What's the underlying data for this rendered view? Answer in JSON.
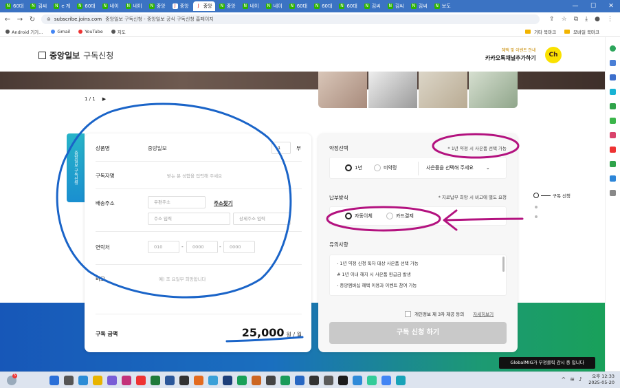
{
  "browser": {
    "tabs": [
      {
        "label": "60대",
        "icon": "N"
      },
      {
        "label": "김씨",
        "icon": "N"
      },
      {
        "label": "e 게",
        "icon": "N"
      },
      {
        "label": "60대",
        "icon": "N"
      },
      {
        "label": "네이",
        "icon": "N"
      },
      {
        "label": "네이",
        "icon": "N"
      },
      {
        "label": "중앙",
        "icon": "N"
      },
      {
        "label": "중앙",
        "icon": "J"
      },
      {
        "label": "중앙",
        "icon": "J",
        "active": true
      },
      {
        "label": "중앙",
        "icon": "N"
      },
      {
        "label": "네이",
        "icon": "N"
      },
      {
        "label": "네이",
        "icon": "N"
      },
      {
        "label": "60대",
        "icon": "N"
      },
      {
        "label": "60대",
        "icon": "N"
      },
      {
        "label": "60대",
        "icon": "N"
      },
      {
        "label": "김씨",
        "icon": "N"
      },
      {
        "label": "김씨",
        "icon": "N"
      },
      {
        "label": "김씨",
        "icon": "N"
      },
      {
        "label": "보도",
        "icon": "N"
      }
    ],
    "url_host": "subscribe.joins.com",
    "url_title": "중앙일보 구독신청 - 중앙일보 공식 구독신청 홈페이지",
    "bookmarks": [
      "Android 기기...",
      "Gmail",
      "YouTube",
      "지도"
    ],
    "bookmark_folders": [
      "기타 북마크",
      "모바일 북마크"
    ]
  },
  "header": {
    "logo": "중앙일보",
    "logo_sub": "구독신청",
    "kakao_small": "혜택 및 이벤트 안내",
    "kakao_big": "카카오톡채널추가하기",
    "kakao_badge": "Ch"
  },
  "pager": {
    "text": "1 / 1",
    "next": "▶"
  },
  "side_tag": "중앙일보 구독신청",
  "form": {
    "product_label": "상품명",
    "product_value": "중앙일보",
    "quantity": "1",
    "quantity_unit": "부",
    "subscriber_label": "구독자명",
    "subscriber_placeholder": "받는 분 성함을 입력해 주세요",
    "address_label": "배송주소",
    "zip_placeholder": "우편주소",
    "find_address": "주소찾기",
    "addr1_placeholder": "주소 입력",
    "addr2_placeholder": "상세주소 입력",
    "phone_label": "연락처",
    "phone1": "010",
    "phone2": "0000",
    "phone3": "0000",
    "dash": "-",
    "memo_label": "비고",
    "memo_placeholder": "예) 조 요일부 희망합니다",
    "price_label": "구독 금액",
    "price_value": "25,000",
    "price_unit": "원 / 월"
  },
  "options": {
    "contract_title": "약정선택",
    "contract_note": "* 1년 약정 시 사은품 선택 가능",
    "contract_1y": "1년",
    "contract_none": "미약정",
    "gift_select": "사은품을 선택해 주세요",
    "payment_title": "납부방식",
    "payment_note": "* 지로납부 희망 시 비고에 별도 요청",
    "pay_auto": "자동이체",
    "pay_card": "카드결제",
    "notice_title": "유의사항",
    "notices": [
      "- 1년 약정 신청 독자 대상 사은품 선택 가능",
      "# 1년 이내 해지 시 사은품 환급금 발생",
      "- 중앙멤버십 혜택 이용과 이벤트 참여 가능"
    ],
    "agree_label": "개인정보 제 3자 제공 동의",
    "agree_link": "자세히보기",
    "submit": "구독 신청 하기"
  },
  "stepnav": {
    "current": "구독 신청"
  },
  "toast": "GlobalMIG가 부정클릭 감시 중 입니다",
  "taskbar": {
    "badge": "5",
    "time": "오후 12:33",
    "date": "2025-05-20"
  },
  "colors": {
    "annotation_blue": "#1a64c8",
    "annotation_magenta": "#b3127f",
    "tab_strip": "#3b73c3",
    "kakao_yellow": "#fae100"
  }
}
